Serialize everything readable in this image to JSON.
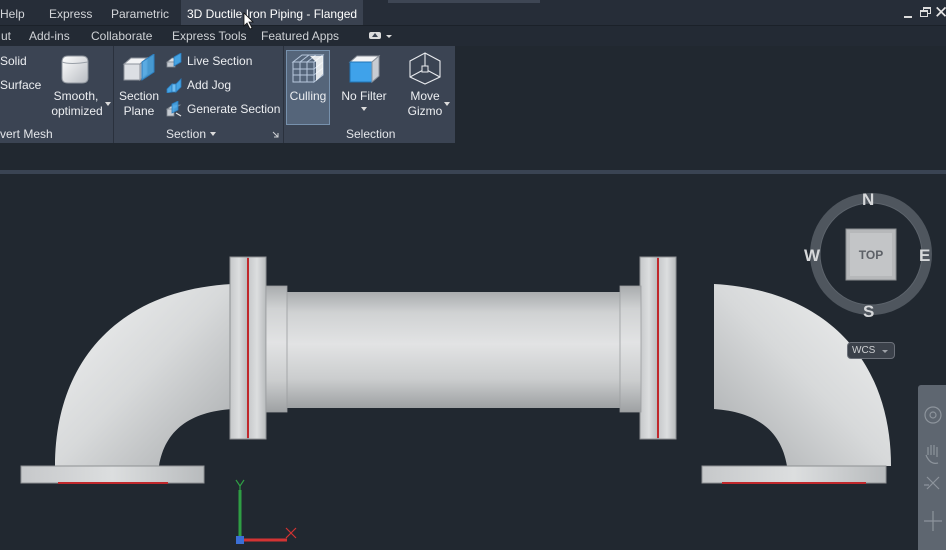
{
  "tabbar": {
    "tabs": [
      {
        "label": "Help"
      },
      {
        "label": "Express"
      },
      {
        "label": "Parametric"
      },
      {
        "label": "3D Ductile Iron Piping - Flanged"
      }
    ]
  },
  "ribbon_tabs": [
    "ut",
    "Add-ins",
    "Collaborate",
    "Express Tools",
    "Featured Apps"
  ],
  "ribbon": {
    "mesh_panel": {
      "items": [
        "Solid",
        "Surface"
      ],
      "smooth_label_line1": "Smooth,",
      "smooth_label_line2": "optimized",
      "footer": "vert Mesh"
    },
    "section_panel": {
      "section_plane_line1": "Section",
      "section_plane_line2": "Plane",
      "live_section": "Live Section",
      "add_jog": "Add Jog",
      "generate_section": "Generate Section",
      "footer": "Section"
    },
    "selection_panel": {
      "culling": "Culling",
      "no_filter": "No Filter",
      "move_gizmo_line1": "Move",
      "move_gizmo_line2": "Gizmo",
      "footer": "Selection"
    }
  },
  "viewcube": {
    "north": "N",
    "south": "S",
    "east": "E",
    "west": "W",
    "face": "TOP",
    "wcs": "WCS"
  },
  "colors": {
    "background": "#212830",
    "ribbon": "#3b4453",
    "pipe": "#d2d4d5",
    "gasket": "#c0282c",
    "ucs_x": "#d03030",
    "ucs_y": "#30a040"
  }
}
